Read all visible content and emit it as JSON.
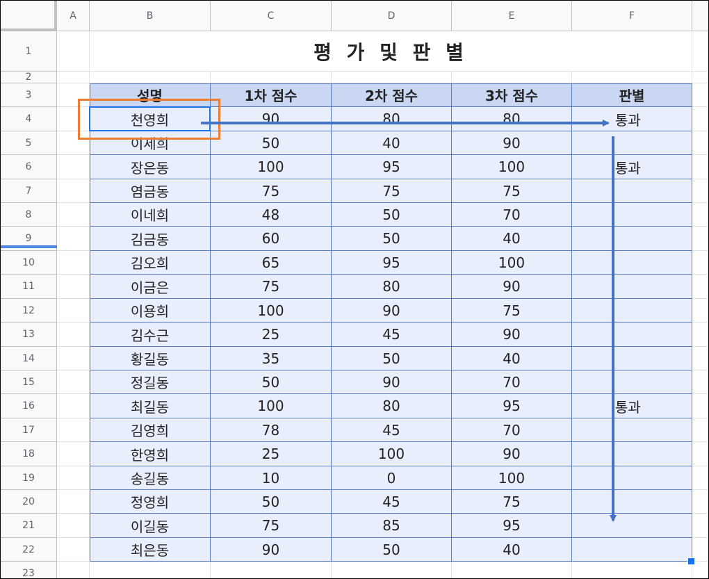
{
  "columns": [
    "A",
    "B",
    "C",
    "D",
    "E",
    "F"
  ],
  "rows": [
    "1",
    "2",
    "3",
    "4",
    "5",
    "6",
    "7",
    "8",
    "9",
    "10",
    "11",
    "12",
    "13",
    "14",
    "15",
    "16",
    "17",
    "18",
    "19",
    "20",
    "21",
    "22",
    "23"
  ],
  "title": "평 가 및 판 별",
  "headers": [
    "성명",
    "1차 점수",
    "2차 점수",
    "3차 점수",
    "판별"
  ],
  "data": [
    [
      "천영희",
      "90",
      "80",
      "80",
      "통과"
    ],
    [
      "이세희",
      "50",
      "40",
      "90",
      ""
    ],
    [
      "장은동",
      "100",
      "95",
      "100",
      "통과"
    ],
    [
      "염금동",
      "75",
      "75",
      "75",
      ""
    ],
    [
      "이네희",
      "48",
      "50",
      "70",
      ""
    ],
    [
      "김금동",
      "60",
      "50",
      "40",
      ""
    ],
    [
      "김오희",
      "65",
      "95",
      "100",
      ""
    ],
    [
      "이금은",
      "75",
      "80",
      "90",
      ""
    ],
    [
      "이용희",
      "100",
      "90",
      "75",
      ""
    ],
    [
      "김수근",
      "25",
      "45",
      "90",
      ""
    ],
    [
      "황길동",
      "35",
      "50",
      "40",
      ""
    ],
    [
      "정길동",
      "50",
      "90",
      "70",
      ""
    ],
    [
      "최길동",
      "100",
      "80",
      "95",
      "통과"
    ],
    [
      "김영희",
      "78",
      "45",
      "70",
      ""
    ],
    [
      "한영희",
      "25",
      "100",
      "90",
      ""
    ],
    [
      "송길동",
      "10",
      "0",
      "100",
      ""
    ],
    [
      "정영희",
      "50",
      "45",
      "75",
      ""
    ],
    [
      "이길동",
      "75",
      "85",
      "95",
      ""
    ],
    [
      "최은동",
      "90",
      "50",
      "40",
      ""
    ]
  ],
  "colors": {
    "arrow": "#4472c4",
    "highlight": "#ed7d31",
    "selection": "#1a73e8",
    "header_fill": "#c9d7f2",
    "table_fill": "#e8eefc"
  }
}
